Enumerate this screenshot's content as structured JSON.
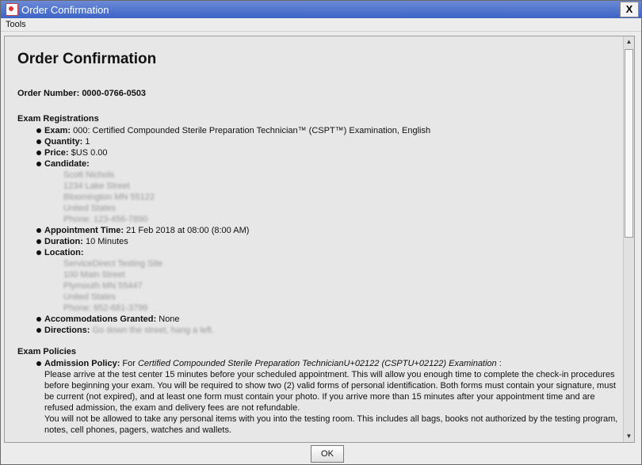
{
  "window": {
    "title": "Order Confirmation",
    "close_label": "X"
  },
  "menu": {
    "tools": "Tools"
  },
  "content": {
    "heading": "Order Confirmation",
    "order_number_label": "Order Number:",
    "order_number": "0000-0766-0503",
    "exam_registrations": {
      "title": "Exam Registrations",
      "exam_label": "Exam:",
      "exam_value": "000: Certified Compounded Sterile Preparation Technician™ (CSPT™) Examination, English",
      "quantity_label": "Quantity:",
      "quantity_value": "1",
      "price_label": "Price:",
      "price_value": "$US 0.00",
      "candidate_label": "Candidate:",
      "candidate_lines": [
        "Scott Nichols",
        "1234 Lake Street",
        "Bloomington MN 55122",
        "United States",
        "Phone: 123-456-7890"
      ],
      "appointment_label": "Appointment Time:",
      "appointment_value": "21 Feb 2018 at 08:00 (8:00 AM)",
      "duration_label": "Duration:",
      "duration_value": "10 Minutes",
      "location_label": "Location:",
      "location_lines": [
        "ServiceDirect Testing Site",
        "100 Main Street",
        "Plymouth MN 55447",
        "United States",
        "Phone: 952-681-3799"
      ],
      "accommodations_label": "Accommodations Granted:",
      "accommodations_value": "None",
      "directions_label": "Directions:",
      "directions_value": "Go down the street, hang a left."
    },
    "exam_policies": {
      "title": "Exam Policies",
      "admission_label": "Admission Policy:",
      "admission_for": "For",
      "admission_exam": "Certified Compounded Sterile Preparation TechnicianU+02122 (CSPTU+02122) Examination",
      "admission_colon": ":",
      "paragraph1": "Please arrive at the test center 15 minutes before your scheduled appointment. This will allow you enough time to complete the check-in procedures before beginning your exam. You will be required to show two (2) valid forms of personal identification. Both forms must contain your signature, must be current (not expired), and at least one form must contain your photo. If you arrive more than 15 minutes after your appointment time and are refused admission, the exam and delivery fees are not refundable.",
      "paragraph2": "You will not be allowed to take any personal items with you into the testing room. This includes all bags, books not authorized by the testing program, notes, cell phones, pagers, watches and wallets."
    }
  },
  "footer": {
    "ok_label": "OK"
  }
}
